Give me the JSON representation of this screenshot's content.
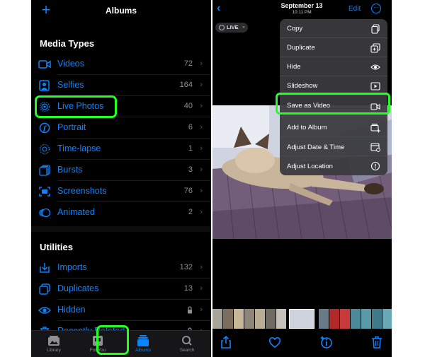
{
  "albums": {
    "header": {
      "title": "Albums",
      "add_label": "+"
    },
    "media_types": {
      "title": "Media Types",
      "items": [
        {
          "label": "Videos",
          "count": "72",
          "icon": "video-icon"
        },
        {
          "label": "Selfies",
          "count": "164",
          "icon": "selfie-icon"
        },
        {
          "label": "Live Photos",
          "count": "40",
          "icon": "live-photo-icon"
        },
        {
          "label": "Portrait",
          "count": "6",
          "icon": "portrait-icon"
        },
        {
          "label": "Time-lapse",
          "count": "1",
          "icon": "timelapse-icon"
        },
        {
          "label": "Bursts",
          "count": "3",
          "icon": "bursts-icon"
        },
        {
          "label": "Screenshots",
          "count": "76",
          "icon": "screenshot-icon"
        },
        {
          "label": "Animated",
          "count": "2",
          "icon": "animated-icon"
        }
      ]
    },
    "utilities": {
      "title": "Utilities",
      "items": [
        {
          "label": "Imports",
          "count": "132",
          "icon": "import-icon"
        },
        {
          "label": "Duplicates",
          "count": "13",
          "icon": "duplicate-icon"
        },
        {
          "label": "Hidden",
          "count": "",
          "icon": "hidden-icon",
          "locked": true
        },
        {
          "label": "Recently Deleted",
          "count": "",
          "icon": "trash-icon",
          "locked": true
        }
      ]
    },
    "tabbar": [
      {
        "label": "Library",
        "icon": "library-icon"
      },
      {
        "label": "For You",
        "icon": "for-you-icon"
      },
      {
        "label": "Albums",
        "icon": "albums-icon",
        "active": true
      },
      {
        "label": "Search",
        "icon": "search-icon"
      }
    ]
  },
  "viewer": {
    "back_label": "‹",
    "date": "September 13",
    "time": "10:11 PM",
    "edit_label": "Edit",
    "more_label": "···",
    "live_badge": {
      "label": "LIVE",
      "caret": "⌄"
    },
    "menu": [
      {
        "label": "Copy",
        "icon": "copy-icon"
      },
      {
        "label": "Duplicate",
        "icon": "duplicate-icon"
      },
      {
        "label": "Hide",
        "icon": "eye-icon"
      },
      {
        "label": "Slideshow",
        "icon": "play-icon"
      },
      {
        "label": "Save as Video",
        "icon": "video-icon",
        "highlighted": true
      },
      {
        "label": "Add to Album",
        "icon": "add-to-album-icon"
      },
      {
        "label": "Adjust Date & Time",
        "icon": "calendar-icon"
      },
      {
        "label": "Adjust Location",
        "icon": "location-icon"
      }
    ],
    "toolbar": [
      {
        "name": "share",
        "icon": "share-icon"
      },
      {
        "name": "favorite",
        "icon": "heart-icon"
      },
      {
        "name": "info",
        "icon": "info-icon"
      },
      {
        "name": "delete",
        "icon": "trash-icon"
      }
    ]
  },
  "colors": {
    "accent": "#0a84ff",
    "highlight": "#22ff22",
    "background": "#000000",
    "menu": "#3a3a3e"
  }
}
